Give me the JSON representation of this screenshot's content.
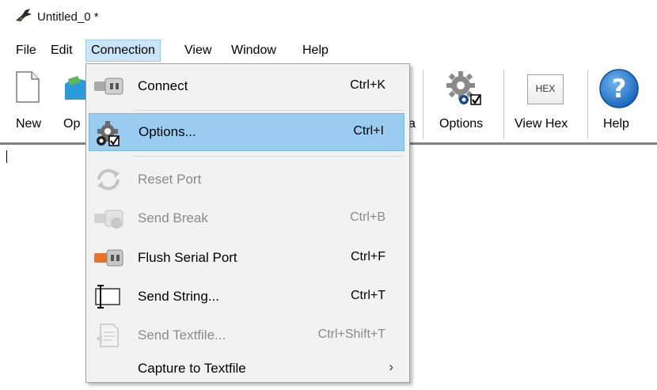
{
  "window": {
    "title": "Untitled_0 *",
    "icon": "app-icon"
  },
  "menubar": {
    "items": [
      {
        "label": "File"
      },
      {
        "label": "Edit"
      },
      {
        "label": "Connection"
      },
      {
        "label": "View"
      },
      {
        "label": "Window"
      },
      {
        "label": "Help"
      }
    ]
  },
  "toolbar": {
    "new_label": "New",
    "open_label_partial": "Op",
    "hidden_partial": "a",
    "options_label": "Options",
    "view_hex_label": "View Hex",
    "hex_badge": "HEX",
    "help_label": "Help"
  },
  "connection_menu": {
    "items": [
      {
        "label": "Connect",
        "shortcut": "Ctrl+K",
        "icon": "connect-icon",
        "enabled": true,
        "highlighted": false
      },
      {
        "label": "Options...",
        "shortcut": "Ctrl+I",
        "icon": "options-gear-icon",
        "enabled": true,
        "highlighted": true
      },
      {
        "label": "Reset Port",
        "shortcut": "",
        "icon": "reset-port-icon",
        "enabled": false,
        "highlighted": false
      },
      {
        "label": "Send Break",
        "shortcut": "Ctrl+B",
        "icon": "send-break-icon",
        "enabled": false,
        "highlighted": false
      },
      {
        "label": "Flush Serial Port",
        "shortcut": "Ctrl+F",
        "icon": "flush-port-icon",
        "enabled": true,
        "highlighted": false
      },
      {
        "label": "Send String...",
        "shortcut": "Ctrl+T",
        "icon": "send-string-icon",
        "enabled": true,
        "highlighted": false
      },
      {
        "label": "Send Textfile...",
        "shortcut": "Ctrl+Shift+T",
        "icon": "send-textfile-icon",
        "enabled": false,
        "highlighted": false
      },
      {
        "label": "Capture to Textfile",
        "shortcut": "",
        "icon": "",
        "enabled": true,
        "highlighted": false,
        "submenu_arrow": "›"
      }
    ]
  },
  "colors": {
    "highlight": "#99ccf0",
    "active_menu": "#cce4f7",
    "disabled_text": "#8a8a8a",
    "help_blue": "#1f7fd8"
  }
}
